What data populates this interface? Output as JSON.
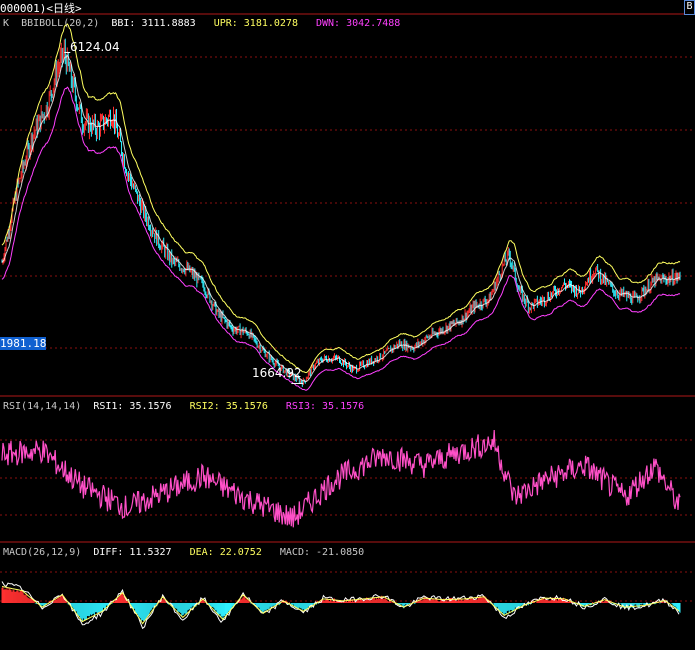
{
  "header": {
    "title": "000001)<日线>",
    "corner_button": "B"
  },
  "panels": {
    "price": {
      "label": "K",
      "indicator": "BBIBOLL(20,2)",
      "items": [
        {
          "label": "BBI:",
          "value": "3111.8883",
          "color": "#ffffff"
        },
        {
          "label": "UPR:",
          "value": "3181.0278",
          "color": "#ffff60"
        },
        {
          "label": "DWN:",
          "value": "3042.7488",
          "color": "#ff40ff"
        }
      ],
      "high_label": "6124.04",
      "low_label": "1664.92",
      "cursor_price": "1981.18"
    },
    "rsi": {
      "indicator": "RSI(14,14,14)",
      "items": [
        {
          "label": "RSI1:",
          "value": "35.1576",
          "color": "#ffffff"
        },
        {
          "label": "RSI2:",
          "value": "35.1576",
          "color": "#ffff60"
        },
        {
          "label": "RSI3:",
          "value": "35.1576",
          "color": "#ff40ff"
        }
      ]
    },
    "macd": {
      "indicator": "MACD(26,12,9)",
      "items": [
        {
          "label": "DIFF:",
          "value": "11.5327",
          "color": "#ffffff"
        },
        {
          "label": "DEA:",
          "value": "22.0752",
          "color": "#ffff60"
        },
        {
          "label": "MACD:",
          "value": "-21.0850",
          "color": "#c8c8c8"
        }
      ]
    }
  },
  "colors": {
    "background": "#000000",
    "grid": "#8a1010",
    "divider": "#b01818",
    "up": "#ff3030",
    "down": "#30f0ff",
    "bbi": "#ffffff",
    "upr": "#ffff60",
    "dwn": "#ff40ff",
    "rsi": "#ff50c8"
  },
  "chart_data": [
    {
      "type": "line",
      "name": "price (daily candles, approximate)",
      "x_unit": "trading-day index",
      "x": [
        0,
        15,
        30,
        45,
        55,
        62,
        70,
        80,
        95,
        110,
        125,
        140,
        155,
        170,
        185,
        200,
        215,
        230,
        245,
        260,
        275,
        290,
        300,
        310,
        320,
        335,
        350,
        365,
        380,
        395,
        410,
        425,
        440,
        455,
        470,
        485,
        500,
        505,
        515,
        525,
        540,
        560,
        575,
        590,
        610,
        630,
        650,
        675
      ],
      "y": [
        3300,
        4300,
        5000,
        5400,
        5900,
        6124,
        5700,
        5200,
        5100,
        5300,
        4500,
        4000,
        3600,
        3300,
        3200,
        3000,
        2600,
        2400,
        2350,
        2100,
        1900,
        1750,
        1680,
        1900,
        2000,
        2000,
        1850,
        1950,
        2050,
        2200,
        2150,
        2300,
        2400,
        2500,
        2700,
        2800,
        3300,
        3400,
        2900,
        2700,
        2800,
        3000,
        2900,
        3200,
        2900,
        2800,
        3050,
        3100
      ],
      "high": 6124.04,
      "low": 1664.92,
      "cursor_value": 1981.18,
      "ylim": [
        1550,
        6400
      ]
    },
    {
      "type": "line",
      "name": "RSI1",
      "x": [
        0,
        40,
        80,
        125,
        160,
        200,
        240,
        290,
        330,
        380,
        420,
        460,
        490,
        510,
        540,
        580,
        620,
        650,
        675
      ],
      "y": [
        60,
        62,
        45,
        35,
        42,
        50,
        40,
        30,
        48,
        60,
        55,
        62,
        66,
        40,
        48,
        55,
        40,
        55,
        35.1576
      ],
      "ylim": [
        20,
        80
      ]
    },
    {
      "type": "bar",
      "name": "MACD histogram (approximate)",
      "x": [
        0,
        20,
        40,
        60,
        80,
        100,
        120,
        140,
        160,
        180,
        200,
        220,
        240,
        260,
        280,
        300,
        320,
        340,
        360,
        380,
        400,
        420,
        440,
        460,
        480,
        500,
        520,
        540,
        560,
        580,
        600,
        620,
        640,
        660,
        675
      ],
      "y": [
        40,
        30,
        -10,
        20,
        -45,
        -20,
        25,
        -50,
        15,
        -35,
        10,
        -40,
        20,
        -25,
        5,
        -20,
        10,
        5,
        10,
        15,
        -10,
        12,
        8,
        10,
        15,
        -30,
        -5,
        12,
        10,
        -8,
        8,
        -10,
        -6,
        6,
        -21.085
      ],
      "ylim": [
        -120,
        120
      ]
    }
  ]
}
